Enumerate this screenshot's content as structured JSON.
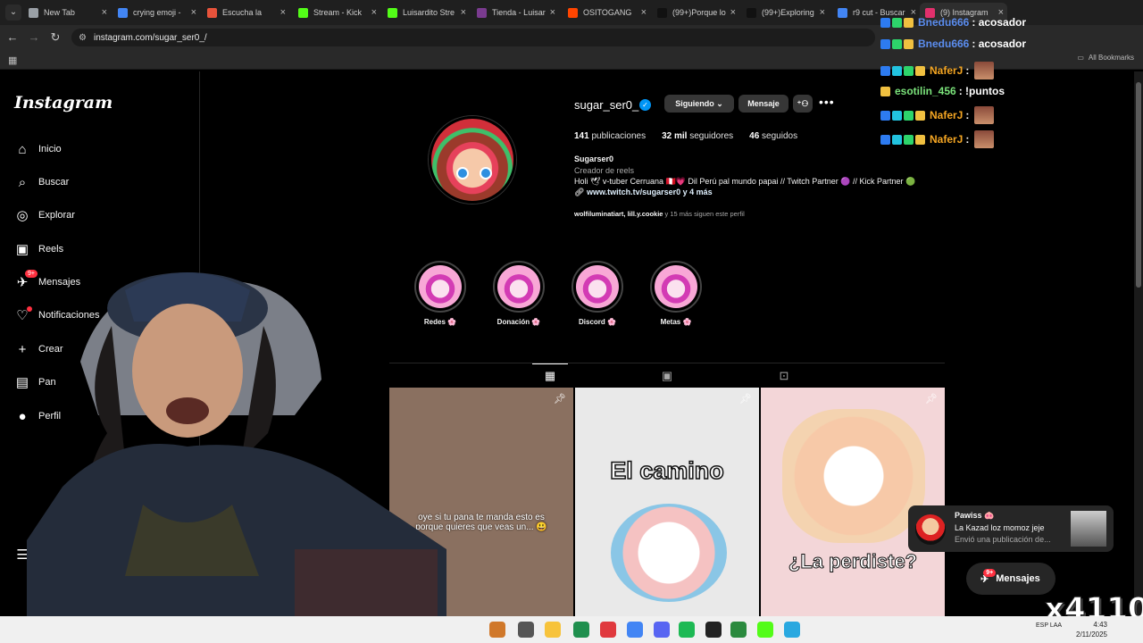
{
  "browser": {
    "tabs": [
      {
        "title": "New Tab",
        "color": "#9aa0a6"
      },
      {
        "title": "crying emoji -",
        "color": "#4285f4"
      },
      {
        "title": "Escucha la",
        "color": "#e7533b"
      },
      {
        "title": "Stream - Kick",
        "color": "#53fc18"
      },
      {
        "title": "Luisardito Stre",
        "color": "#53fc18"
      },
      {
        "title": "Tienda - Luisar",
        "color": "#7a3b8f"
      },
      {
        "title": "OSITOGANG",
        "color": "#ff4500"
      },
      {
        "title": "(99+)Porque lo",
        "color": "#111111"
      },
      {
        "title": "(99+)Exploring",
        "color": "#111111"
      },
      {
        "title": "r9 cut - Buscar",
        "color": "#4285f4"
      },
      {
        "title": "(9) Instagram",
        "color": "#e1306c"
      }
    ],
    "url": "instagram.com/sugar_ser0_/",
    "all_bookmarks": "All Bookmarks"
  },
  "sidebar": {
    "logo": "Instagram",
    "items": [
      {
        "label": "Inicio",
        "icon": "home-icon",
        "glyph": "⌂"
      },
      {
        "label": "Buscar",
        "icon": "search-icon",
        "glyph": "⌕"
      },
      {
        "label": "Explorar",
        "icon": "compass-icon",
        "glyph": "◎"
      },
      {
        "label": "Reels",
        "icon": "reels-icon",
        "glyph": "▣"
      },
      {
        "label": "Mensajes",
        "icon": "messenger-icon",
        "glyph": "✈",
        "badge": "9+"
      },
      {
        "label": "Notificaciones",
        "icon": "heart-icon",
        "glyph": "♡"
      },
      {
        "label": "Crear",
        "icon": "plus-icon",
        "glyph": "+"
      },
      {
        "label": "Pan",
        "icon": "dashboard-icon",
        "glyph": "▤"
      },
      {
        "label": "Perfil",
        "icon": "profile-avatar-icon",
        "glyph": "●"
      }
    ],
    "menu_glyph": "☰"
  },
  "profile": {
    "username": "sugar_ser0_",
    "verified_glyph": "✓",
    "following_button": "Siguiendo",
    "message_button": "Mensaje",
    "more": "•••",
    "posts_count": "141",
    "posts_label": "publicaciones",
    "followers_count": "32 mil",
    "followers_label": "seguidores",
    "following_count": "46",
    "following_label": "seguidos",
    "full_name": "Sugarser0",
    "category": "Creador de reels",
    "bio": "Holi 🕊 v-tuber Cerruana 🇵🇪💗 Dil Perú pal mundo papai // Twitch Partner 🟣 // Kick Partner 🟢",
    "link": "www.twitch.tv/sugarser0 y 4 más",
    "followed_by_names": "wolfiluminatiart, lill.y.cookie",
    "followed_by_rest": " y 15 más siguen este perfil"
  },
  "highlights": [
    {
      "label": "Redes 🌸"
    },
    {
      "label": "Donación 🌸"
    },
    {
      "label": "Discord 🌸"
    },
    {
      "label": "Metas 🌸"
    }
  ],
  "posts": [
    {
      "caption": "oye si tu pana te manda esto es porque quieres que veas un... 😃",
      "bg": "#8a7060"
    },
    {
      "caption": "El camino",
      "bg": "#e9e9e9"
    },
    {
      "caption": "¿La perdiste?",
      "bg": "#f3d6d8"
    }
  ],
  "chat": [
    {
      "user": "Bnedu666",
      "message": ": acosador",
      "user_color": "#5b8def"
    },
    {
      "user": "Bnedu666",
      "message": ": acosador",
      "user_color": "#5b8def"
    },
    {
      "user": "NaferJ",
      "message": ":",
      "user_color": "#f5a623"
    },
    {
      "user": "esotilin_456",
      "message": ": !puntos",
      "user_color": "#7be37b"
    },
    {
      "user": "NaferJ",
      "message": ":",
      "user_color": "#f5a623"
    },
    {
      "user": "NaferJ",
      "message": ":",
      "user_color": "#f5a623"
    }
  ],
  "notification": {
    "user": "Pawiss 🐽",
    "title": "La Kazad loz momoz jeje",
    "body": "Envió una publicación de..."
  },
  "dm_pill": {
    "label": "Mensajes",
    "badge": "9+"
  },
  "overlay_multiplier": "x4110",
  "tray": {
    "time": "4:43",
    "date": "2/11/2025",
    "lang": "ESP LAA"
  }
}
